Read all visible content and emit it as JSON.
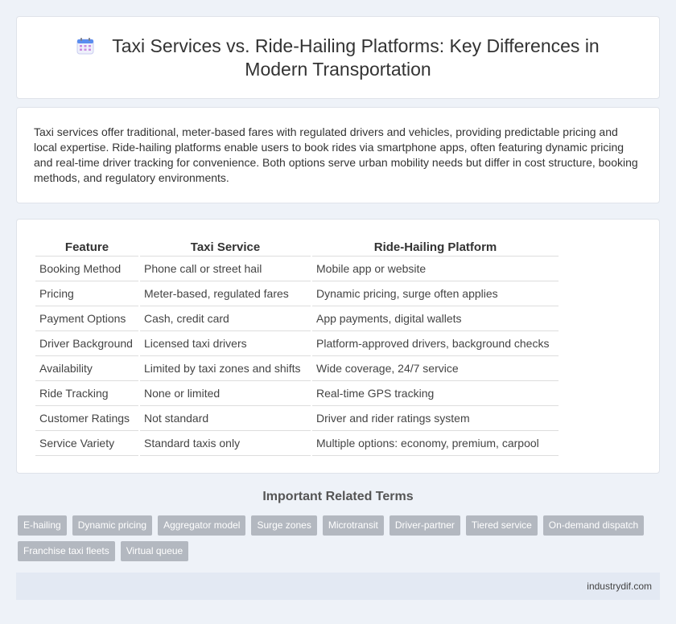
{
  "header": {
    "title_line1": "Taxi Services vs. Ride-Hailing Platforms: Key Differences in",
    "title_line2": "Modern Transportation",
    "icon": "calendar-icon"
  },
  "summary": "Taxi services offer traditional, meter-based fares with regulated drivers and vehicles, providing predictable pricing and local expertise. Ride-hailing platforms enable users to book rides via smartphone apps, often featuring dynamic pricing and real-time driver tracking for convenience. Both options serve urban mobility needs but differ in cost structure, booking methods, and regulatory environments.",
  "table": {
    "headers": [
      "Feature",
      "Taxi Service",
      "Ride-Hailing Platform"
    ],
    "rows": [
      [
        "Booking Method",
        "Phone call or street hail",
        "Mobile app or website"
      ],
      [
        "Pricing",
        "Meter-based, regulated fares",
        "Dynamic pricing, surge often applies"
      ],
      [
        "Payment Options",
        "Cash, credit card",
        "App payments, digital wallets"
      ],
      [
        "Driver Background",
        "Licensed taxi drivers",
        "Platform-approved drivers, background checks"
      ],
      [
        "Availability",
        "Limited by taxi zones and shifts",
        "Wide coverage, 24/7 service"
      ],
      [
        "Ride Tracking",
        "None or limited",
        "Real-time GPS tracking"
      ],
      [
        "Customer Ratings",
        "Not standard",
        "Driver and rider ratings system"
      ],
      [
        "Service Variety",
        "Standard taxis only",
        "Multiple options: economy, premium, carpool"
      ]
    ]
  },
  "related": {
    "title": "Important Related Terms",
    "tags": [
      "E-hailing",
      "Dynamic pricing",
      "Aggregator model",
      "Surge zones",
      "Microtransit",
      "Driver-partner",
      "Tiered service",
      "On-demand dispatch",
      "Franchise taxi fleets",
      "Virtual queue"
    ]
  },
  "footer": {
    "site": "industrydif.com"
  },
  "colors": {
    "background": "#eef2f8",
    "tag": "#b3b8c0",
    "footer": "#e3e9f3"
  }
}
